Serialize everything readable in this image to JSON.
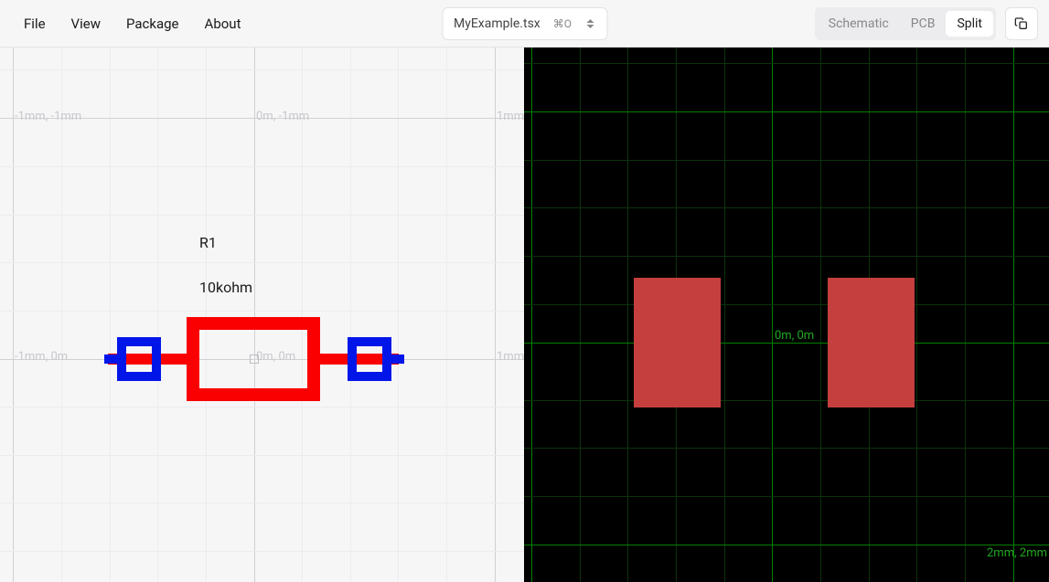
{
  "menu": {
    "file": "File",
    "view": "View",
    "package": "Package",
    "about": "About"
  },
  "header": {
    "filename": "MyExample.tsx",
    "shortcut": "⌘O"
  },
  "viewToggle": {
    "schematic": "Schematic",
    "pcb": "PCB",
    "split": "Split",
    "active": "Split"
  },
  "schematic": {
    "coords": {
      "topLeft": "-1mm, -1mm",
      "topMid": "0m, -1mm",
      "topRight": "1mm",
      "midLeft": "-1mm, 0m",
      "origin": "0m, 0m",
      "midRight": "1mm"
    },
    "component": {
      "ref": "R1",
      "value": "10kohm"
    }
  },
  "pcb": {
    "coords": {
      "origin": "0m, 0m",
      "bottomRight": "2mm, 2mm"
    }
  }
}
